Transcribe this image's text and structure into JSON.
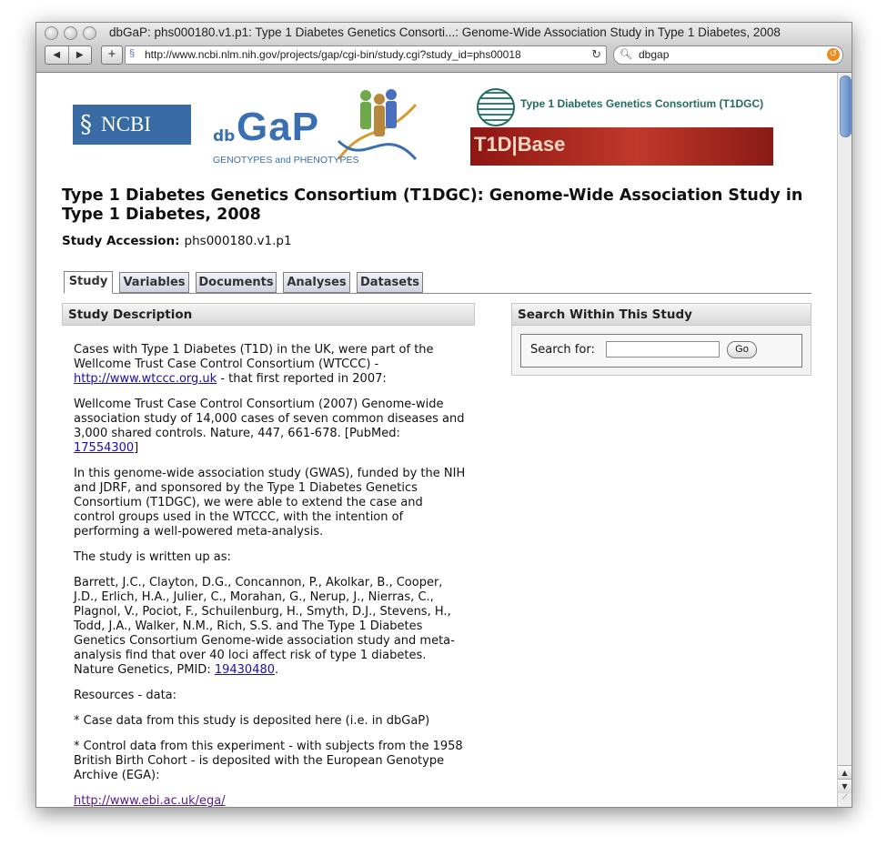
{
  "window": {
    "title": "dbGaP: phs000180.v1.p1: Type 1 Diabetes Genetics Consorti...: Genome-Wide Association Study in Type 1 Diabetes, 2008"
  },
  "toolbar": {
    "back": "◀",
    "forward": "▶",
    "add": "+",
    "url": "http://www.ncbi.nlm.nih.gov/projects/gap/cgi-bin/study.cgi?study_id=phs00018",
    "search_query": "dbgap"
  },
  "header": {
    "ncbi_logo": "NCBI",
    "dbgap_db": "db",
    "dbgap_gap": "GaP",
    "dbgap_tagline": "GENOTYPES and PHENOTYPES",
    "t1dgc_name": "Type 1 Diabetes Genetics Consortium (T1DGC)",
    "t1dbase": "T1D|Base"
  },
  "page": {
    "title": "Type 1 Diabetes Genetics Consortium (T1DGC): Genome-Wide Association Study in Type 1 Diabetes, 2008",
    "accession_label": "Study Accession:",
    "accession_value": "phs000180.v1.p1"
  },
  "tabs": [
    {
      "label": "Study",
      "active": true
    },
    {
      "label": "Variables",
      "active": false
    },
    {
      "label": "Documents",
      "active": false
    },
    {
      "label": "Analyses",
      "active": false
    },
    {
      "label": "Datasets",
      "active": false
    }
  ],
  "description": {
    "heading": "Study Description",
    "p1_a": "Cases with Type 1 Diabetes (T1D) in the UK, were part of the Wellcome Trust Case Control Consortium (WTCCC) - ",
    "p1_link": "http://www.wtccc.org.uk",
    "p1_b": " - that first reported in 2007:",
    "p2_a": "Wellcome Trust Case Control Consortium (2007) Genome-wide association study of 14,000 cases of seven common diseases and 3,000 shared controls. Nature, 447, 661-678. [PubMed: ",
    "p2_link": "17554300",
    "p2_b": "]",
    "p3": "In this genome-wide association study (GWAS), funded by the NIH and JDRF, and sponsored by the Type 1 Diabetes Genetics Consortium (T1DGC), we were able to extend the case and control groups used in the WTCCC, with the intention of performing a well-powered meta-analysis.",
    "p4": "The study is written up as:",
    "p5_a": "Barrett, J.C., Clayton, D.G., Concannon, P., Akolkar, B., Cooper, J.D., Erlich, H.A., Julier, C., Morahan, G., Nerup, J., Nierras, C., Plagnol, V., Pociot, F., Schuilenburg, H., Smyth, D.J., Stevens, H., Todd, J.A., Walker, N.M., Rich, S.S. and The Type 1 Diabetes Genetics Consortium Genome-wide association study and meta-analysis find that over 40 loci affect risk of type 1 diabetes. Nature Genetics, PMID: ",
    "p5_link": "19430480",
    "p5_b": ".",
    "p6": "Resources - data:",
    "p7": "* Case data from this study is deposited here (i.e. in dbGaP)",
    "p8": "* Control data from this experiment - with subjects from the 1958 British Birth Cohort - is deposited with the European Genotype Archive (EGA):",
    "p9_link": "http://www.ebi.ac.uk/ega/"
  },
  "search_panel": {
    "heading": "Search Within This Study",
    "label": "Search for:",
    "input_value": "",
    "button": "Go"
  },
  "colors": {
    "ncbi_blue": "#386aa4",
    "link": "#1a0dab",
    "visited_link": "#551a8b",
    "t1dbase_red": "#b02a22"
  }
}
